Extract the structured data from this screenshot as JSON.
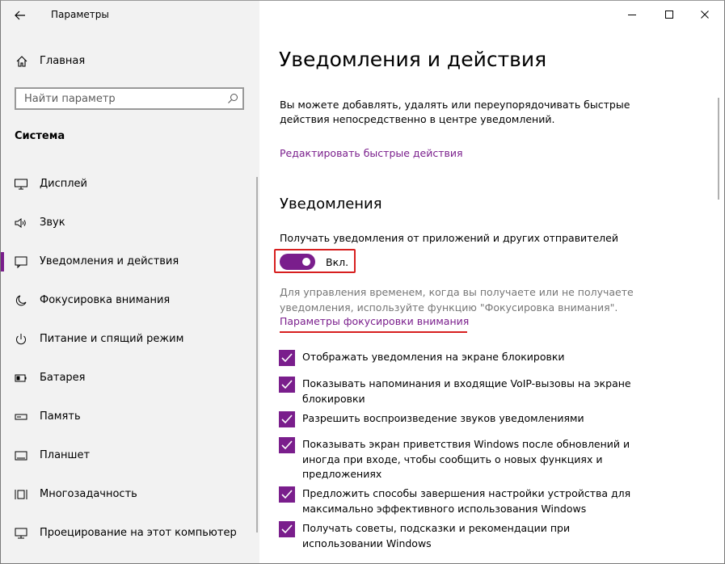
{
  "window": {
    "title": "Параметры",
    "accent_color": "#7a1e8c",
    "highlight_color": "#d71f1f"
  },
  "sidebar": {
    "home_label": "Главная",
    "search_placeholder": "Найти параметр",
    "section_label": "Система",
    "items": [
      {
        "label": "Дисплей",
        "icon": "monitor-icon"
      },
      {
        "label": "Звук",
        "icon": "speaker-icon"
      },
      {
        "label": "Уведомления и действия",
        "icon": "notification-icon",
        "active": true
      },
      {
        "label": "Фокусировка внимания",
        "icon": "moon-icon"
      },
      {
        "label": "Питание и спящий режим",
        "icon": "power-icon"
      },
      {
        "label": "Батарея",
        "icon": "battery-icon"
      },
      {
        "label": "Память",
        "icon": "storage-icon"
      },
      {
        "label": "Планшет",
        "icon": "tablet-icon"
      },
      {
        "label": "Многозадачность",
        "icon": "multitasking-icon"
      },
      {
        "label": "Проецирование на этот компьютер",
        "icon": "projection-icon"
      }
    ]
  },
  "main": {
    "title": "Уведомления и действия",
    "description": "Вы можете добавлять, удалять или переупорядочивать быстрые действия непосредственно в центре уведомлений.",
    "edit_quick_actions_link": "Редактировать быстрые действия",
    "notifications_heading": "Уведомления",
    "toggle_caption": "Получать уведомления от приложений и других отправителей",
    "toggle_state": "Вкл.",
    "toggle_on": true,
    "focus_hint": "Для управления временем, когда вы получаете или не получаете уведомления, используйте функцию \"Фокусировка внимания\".",
    "focus_link": "Параметры фокусировки внимания",
    "checkboxes": [
      {
        "label": "Отображать уведомления на экране блокировки",
        "checked": true
      },
      {
        "label": "Показывать напоминания и входящие VoIP-вызовы на экране блокировки",
        "checked": true
      },
      {
        "label": "Разрешить  воспроизведение звуков уведомлениями",
        "checked": true
      },
      {
        "label": "Показывать экран приветствия Windows после обновлений и иногда при входе, чтобы сообщить о новых функциях и предложениях",
        "checked": true
      },
      {
        "label": "Предложить способы завершения настройки устройства для максимально эффективного использования Windows",
        "checked": true
      },
      {
        "label": "Получать советы, подсказки и рекомендации при использовании Windows",
        "checked": true
      }
    ]
  }
}
